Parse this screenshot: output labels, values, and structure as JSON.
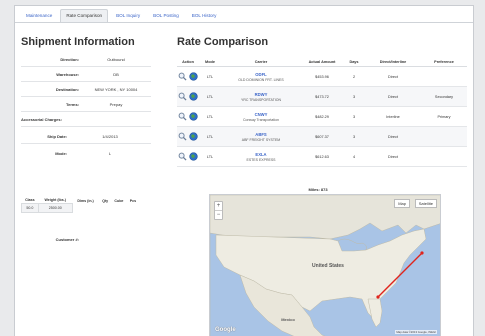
{
  "tabs": [
    {
      "label": "Maintenance",
      "active": false
    },
    {
      "label": "Rate Comparison",
      "active": true
    },
    {
      "label": "BOL Inquiry",
      "active": false
    },
    {
      "label": "BOL Posting",
      "active": false
    },
    {
      "label": "BOL History",
      "active": false
    }
  ],
  "shipment": {
    "title": "Shipment Information",
    "direction_label": "Direction:",
    "direction": "Outbound",
    "warehouse_label": "Warehouse:",
    "warehouse": "DB",
    "destination_label": "Destination:",
    "destination": "NEW YORK , NY 10004",
    "terms_label": "Terms:",
    "terms": "Prepay",
    "accessorial_label": "Accessorial Charges:",
    "ship_date_label": "Ship Date:",
    "ship_date": "1/4/2013",
    "mode_label": "Mode:",
    "mode": "L",
    "weights": {
      "headers": [
        "Class",
        "Weight (lbs.)",
        "Dims (in.)",
        "Qty",
        "Cube",
        "Pcs"
      ],
      "row": [
        "50.0",
        "2500.00",
        "",
        "",
        "",
        ""
      ]
    },
    "customer_label": "Customer #:"
  },
  "rates": {
    "title": "Rate Comparison",
    "headers": [
      "Action",
      "Mode",
      "Carrier",
      "Actual Amount",
      "Days",
      "Direct/Interline",
      "Preference"
    ],
    "rows": [
      {
        "mode": "LTL",
        "code": "ODFL",
        "name": "OLD DOMINION FRT. LINES",
        "amount": "$453.96",
        "days": "2",
        "direct": "Direct",
        "preference": ""
      },
      {
        "mode": "LTL",
        "code": "RDWY",
        "name": "YRC TRANSPORTATION",
        "amount": "$473.72",
        "days": "3",
        "direct": "Direct",
        "preference": "Secondary"
      },
      {
        "mode": "LTL",
        "code": "CNWY",
        "name": "Conway Transportation",
        "amount": "$482.29",
        "days": "3",
        "direct": "Interline",
        "preference": "Primary"
      },
      {
        "mode": "LTL",
        "code": "ABFS",
        "name": "ABF FREIGHT SYSTEM",
        "amount": "$607.37",
        "days": "3",
        "direct": "Direct",
        "preference": ""
      },
      {
        "mode": "LTL",
        "code": "EXLA",
        "name": "ESTES EXPRESS",
        "amount": "$612.63",
        "days": "4",
        "direct": "Direct",
        "preference": ""
      }
    ]
  },
  "map": {
    "miles_label": "Miles: 873",
    "country_label": "United States",
    "mexico_label": "Mexico",
    "google_label": "Google",
    "attribution": "Map data ©2013 Google, INEGI",
    "zoom_in": "+",
    "zoom_out": "−",
    "map_type_options": [
      "Map",
      "Satellite"
    ],
    "route_color": "#e0241c",
    "water_color": "#a9c4e6",
    "land_color": "#eeece2"
  }
}
